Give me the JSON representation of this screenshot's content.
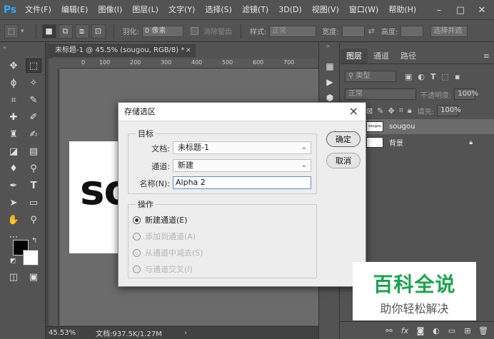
{
  "app": {
    "logo": "Ps"
  },
  "menu": [
    "文件(F)",
    "编辑(E)",
    "图像(I)",
    "图层(L)",
    "文字(Y)",
    "选择(S)",
    "滤镜(T)",
    "3D(D)",
    "视图(V)",
    "窗口(W)",
    "帮助(H)"
  ],
  "options": {
    "feather_label": "羽化:",
    "feather_value": "0 像素",
    "antialias_label": "消除锯齿",
    "style_label": "样式:",
    "style_value": "正常",
    "width_label": "宽度:",
    "height_label": "高度:",
    "select_mask_label": "选择并遮"
  },
  "document": {
    "tab_title": "未标题-1 @ 45.5% (sougou, RGB/8) *",
    "canvas_text": "so",
    "zoom": "45.53%",
    "doc_info": "文档:937.5K/1.27M",
    "ruler_ticks": [
      "0",
      "100",
      "200",
      "300",
      "400",
      "500",
      "600",
      "700"
    ]
  },
  "layers_panel": {
    "tabs": [
      "图层",
      "通道",
      "路径"
    ],
    "filter_label": "类型",
    "blend_mode": "正常",
    "opacity_label": "不透明度:",
    "opacity_value": "100%",
    "fill_label": "填充:",
    "fill_value": "100%",
    "layers": [
      {
        "name": "sougou",
        "thumb_text": "sougou"
      },
      {
        "name": "背景"
      }
    ]
  },
  "dialog": {
    "title": "存储选区",
    "target_group": "目标",
    "doc_label": "文档:",
    "doc_value": "未标题-1",
    "channel_label": "通道:",
    "channel_value": "新建",
    "name_label": "名称(N):",
    "name_value": "Alpha 2",
    "operation_group": "操作",
    "ops": [
      "新建通道(E)",
      "添加到通道(A)",
      "从通道中减去(S)",
      "与通道交叉(I)"
    ],
    "ok": "确定",
    "cancel": "取消"
  },
  "watermark": {
    "title": "百科全说",
    "subtitle": "助你轻松解决"
  },
  "colors": {
    "ps_blue": "#31a8ff",
    "watermark_green": "#1aa44d"
  }
}
